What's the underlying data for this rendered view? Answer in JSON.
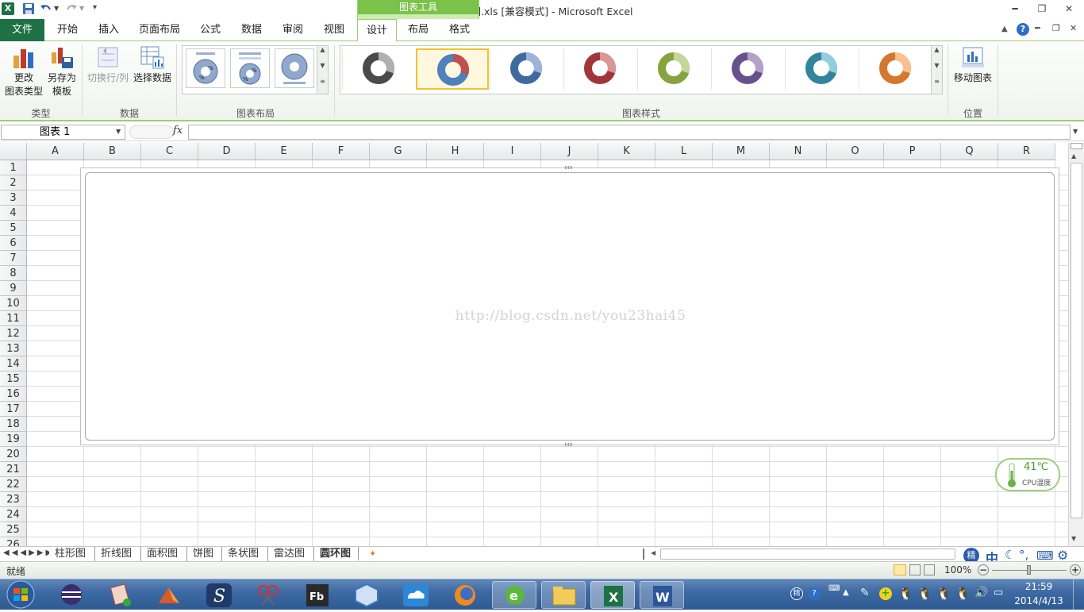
{
  "window": {
    "title": "柱形图.xls  [兼容模式] - Microsoft Excel",
    "context_tab_group": "图表工具"
  },
  "tabs": [
    {
      "label": "文件"
    },
    {
      "label": "开始"
    },
    {
      "label": "插入"
    },
    {
      "label": "页面布局"
    },
    {
      "label": "公式"
    },
    {
      "label": "数据"
    },
    {
      "label": "审阅"
    },
    {
      "label": "视图"
    },
    {
      "label": "设计"
    },
    {
      "label": "布局"
    },
    {
      "label": "格式"
    }
  ],
  "ribbon": {
    "groups": {
      "type": "类型",
      "data": "数据",
      "layout": "图表布局",
      "styles": "图表样式",
      "location": "位置"
    },
    "buttons": {
      "change_type_l1": "更改",
      "change_type_l2": "图表类型",
      "save_template_l1": "另存为",
      "save_template_l2": "模板",
      "switch_rowcol": "切换行/列",
      "select_data": "选择数据",
      "move_chart": "移动图表"
    }
  },
  "chart_styles": [
    {
      "base": "#4a4a4a",
      "accent": "#b0b0b0"
    },
    {
      "base": "#4f81bd",
      "accent": "#c0504d"
    },
    {
      "base": "#3f6aa0",
      "accent": "#9db3d6"
    },
    {
      "base": "#a0363a",
      "accent": "#d99694"
    },
    {
      "base": "#85a33e",
      "accent": "#c3d69b"
    },
    {
      "base": "#6a4f8e",
      "accent": "#b3a2c7"
    },
    {
      "base": "#31859c",
      "accent": "#93cddd"
    },
    {
      "base": "#d4782f",
      "accent": "#fac090"
    }
  ],
  "formula_bar": {
    "name_box": "图表 1",
    "fx_label": "fx"
  },
  "columns": [
    "A",
    "B",
    "C",
    "D",
    "E",
    "F",
    "G",
    "H",
    "I",
    "J",
    "K",
    "L",
    "M",
    "N",
    "O",
    "P",
    "Q",
    "R"
  ],
  "rows": [
    "1",
    "2",
    "3",
    "4",
    "5",
    "6",
    "7",
    "8",
    "9",
    "10",
    "11",
    "12",
    "13",
    "14",
    "15",
    "16",
    "17",
    "18",
    "19",
    "20",
    "21",
    "22",
    "23",
    "24",
    "25",
    "26"
  ],
  "chart": {
    "watermark": "http://blog.csdn.net/you23hai45"
  },
  "sheets": [
    {
      "label": "柱形图"
    },
    {
      "label": "折线图"
    },
    {
      "label": "面积图"
    },
    {
      "label": "饼图"
    },
    {
      "label": "条状图"
    },
    {
      "label": "雷达图"
    },
    {
      "label": "圆环图"
    }
  ],
  "status": {
    "ready": "就绪",
    "zoom": "100%"
  },
  "cpu_widget": {
    "temp": "41℃",
    "label": "CPU温度"
  },
  "clock": {
    "time": "21:59",
    "date": "2014/4/13"
  },
  "ime": {
    "mode": "中"
  },
  "colors": {
    "excel_green": "#1e7145",
    "context_green": "#7bc24b",
    "selected_border": "#f2c12e",
    "taskbar": "#3e6aa3"
  }
}
